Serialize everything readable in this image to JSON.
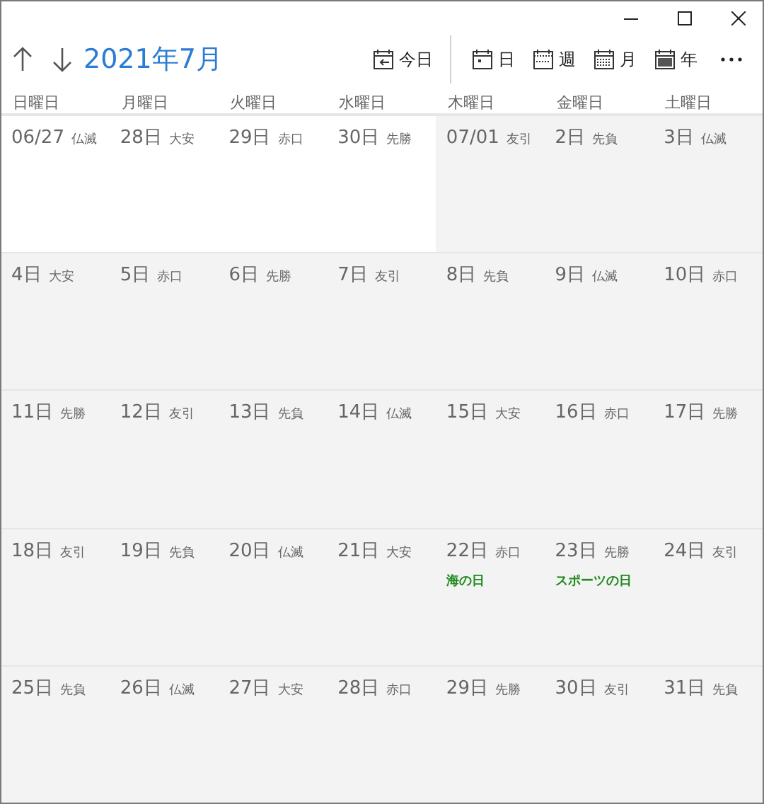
{
  "title": "2021年7月",
  "toolbar": [
    {
      "kind": "today",
      "label": "今日"
    },
    {
      "kind": "day",
      "label": "日"
    },
    {
      "kind": "week",
      "label": "週"
    },
    {
      "kind": "month",
      "label": "月"
    },
    {
      "kind": "year",
      "label": "年"
    }
  ],
  "weekdays": [
    "日曜日",
    "月曜日",
    "火曜日",
    "水曜日",
    "木曜日",
    "金曜日",
    "土曜日"
  ],
  "weeks": [
    [
      {
        "date": "06/27",
        "rokuyo": "仏滅",
        "in_month": false
      },
      {
        "date": "28日",
        "rokuyo": "大安",
        "in_month": false
      },
      {
        "date": "29日",
        "rokuyo": "赤口",
        "in_month": false
      },
      {
        "date": "30日",
        "rokuyo": "先勝",
        "in_month": false
      },
      {
        "date": "07/01",
        "rokuyo": "友引",
        "in_month": true
      },
      {
        "date": "2日",
        "rokuyo": "先負",
        "in_month": true
      },
      {
        "date": "3日",
        "rokuyo": "仏滅",
        "in_month": true
      }
    ],
    [
      {
        "date": "4日",
        "rokuyo": "大安",
        "in_month": true
      },
      {
        "date": "5日",
        "rokuyo": "赤口",
        "in_month": true
      },
      {
        "date": "6日",
        "rokuyo": "先勝",
        "in_month": true
      },
      {
        "date": "7日",
        "rokuyo": "友引",
        "in_month": true
      },
      {
        "date": "8日",
        "rokuyo": "先負",
        "in_month": true
      },
      {
        "date": "9日",
        "rokuyo": "仏滅",
        "in_month": true
      },
      {
        "date": "10日",
        "rokuyo": "赤口",
        "in_month": true
      }
    ],
    [
      {
        "date": "11日",
        "rokuyo": "先勝",
        "in_month": true
      },
      {
        "date": "12日",
        "rokuyo": "友引",
        "in_month": true
      },
      {
        "date": "13日",
        "rokuyo": "先負",
        "in_month": true
      },
      {
        "date": "14日",
        "rokuyo": "仏滅",
        "in_month": true
      },
      {
        "date": "15日",
        "rokuyo": "大安",
        "in_month": true
      },
      {
        "date": "16日",
        "rokuyo": "赤口",
        "in_month": true
      },
      {
        "date": "17日",
        "rokuyo": "先勝",
        "in_month": true
      }
    ],
    [
      {
        "date": "18日",
        "rokuyo": "友引",
        "in_month": true
      },
      {
        "date": "19日",
        "rokuyo": "先負",
        "in_month": true
      },
      {
        "date": "20日",
        "rokuyo": "仏滅",
        "in_month": true
      },
      {
        "date": "21日",
        "rokuyo": "大安",
        "in_month": true
      },
      {
        "date": "22日",
        "rokuyo": "赤口",
        "in_month": true,
        "events": [
          {
            "title": "海の日",
            "color": "#218a21"
          }
        ]
      },
      {
        "date": "23日",
        "rokuyo": "先勝",
        "in_month": true,
        "events": [
          {
            "title": "スポーツの日",
            "color": "#218a21"
          }
        ]
      },
      {
        "date": "24日",
        "rokuyo": "友引",
        "in_month": true
      }
    ],
    [
      {
        "date": "25日",
        "rokuyo": "先負",
        "in_month": true
      },
      {
        "date": "26日",
        "rokuyo": "仏滅",
        "in_month": true
      },
      {
        "date": "27日",
        "rokuyo": "大安",
        "in_month": true
      },
      {
        "date": "28日",
        "rokuyo": "赤口",
        "in_month": true
      },
      {
        "date": "29日",
        "rokuyo": "先勝",
        "in_month": true
      },
      {
        "date": "30日",
        "rokuyo": "友引",
        "in_month": true
      },
      {
        "date": "31日",
        "rokuyo": "先負",
        "in_month": true
      }
    ]
  ]
}
